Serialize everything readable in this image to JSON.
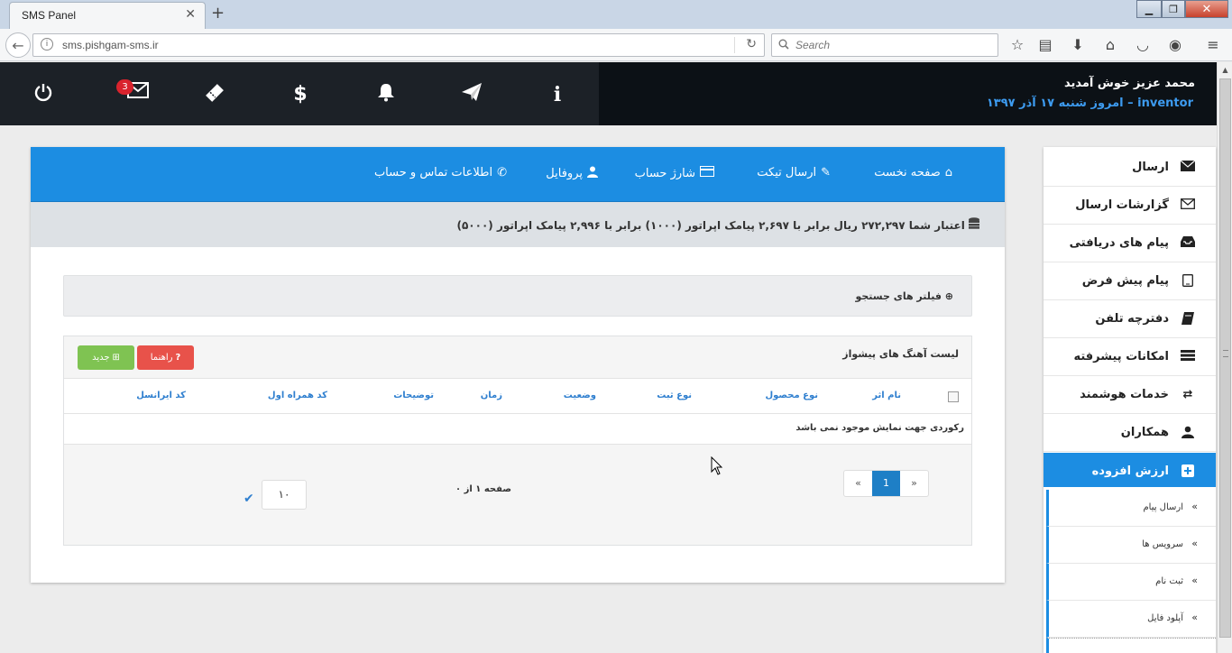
{
  "browser": {
    "tab_title": "SMS Panel",
    "url": "sms.pishgam-sms.ir",
    "search_placeholder": "Search"
  },
  "header": {
    "welcome": "محمد عزیز خوش آمدید",
    "user_line": "inventor – امروز شنبه ۱۷ آذر ۱۳۹۷",
    "mail_badge": "3",
    "icons": [
      "power-icon",
      "mail-icon",
      "ticket-icon",
      "dollar-icon",
      "bell-icon",
      "send-icon",
      "info-icon"
    ]
  },
  "panel": {
    "tabs": [
      {
        "label": "صفحه نخست",
        "icon": "home-icon"
      },
      {
        "label": "ارسال تیکت",
        "icon": "ticket-icon"
      },
      {
        "label": "شارژ حساب",
        "icon": "credit-card-icon"
      },
      {
        "label": "پروفایل",
        "icon": "user-icon"
      },
      {
        "label": "اطلاعات تماس و حساب",
        "icon": "phone-icon"
      }
    ],
    "credit": "اعتبار شما ۲۷۲,۲۹۷ ریال برابر با ۲,۶۹۷ پیامک اپراتور (۱۰۰۰) برابر با ۲,۹۹۶ پیامک اپراتور (۵۰۰۰)",
    "filter_label": "فیلتر های جستجو",
    "list_title": "لیست آهنگ های پیشواز",
    "help_button": "راهنما",
    "new_button": "جدید",
    "columns": [
      "نام اثر",
      "نوع محصول",
      "نوع ثبت",
      "وضعیت",
      "زمان",
      "توضیحات",
      "کد همراه اول",
      "کد ایرانسل"
    ],
    "empty_message": "رکوردی جهت نمایش موجود نمی باشد",
    "pager": {
      "prev": "«",
      "current": "1",
      "next": "»"
    },
    "page_info": "صفحه ۱ از ۰",
    "page_size": "۱۰"
  },
  "sidebar": {
    "items": [
      {
        "label": "ارسال",
        "icon": "envelope-icon"
      },
      {
        "label": "گزارشات ارسال",
        "icon": "envelope-outline-icon"
      },
      {
        "label": "پیام های دریافتی",
        "icon": "inbox-icon"
      },
      {
        "label": "پیام پیش فرض",
        "icon": "tablet-icon"
      },
      {
        "label": "دفترچه تلفن",
        "icon": "book-icon"
      },
      {
        "label": "امکانات پیشرفته",
        "icon": "list-icon"
      },
      {
        "label": "خدمات هوشمند",
        "icon": "retweet-icon"
      },
      {
        "label": "همکاران",
        "icon": "users-icon"
      },
      {
        "label": "ارزش افزوده",
        "icon": "plus-square-icon"
      }
    ],
    "sub_items": [
      "ارسال پیام",
      "سرویس ها",
      "ثبت نام",
      "آپلود فایل"
    ]
  },
  "colors": {
    "primary": "#1c8de2",
    "header_bg": "#1c2127",
    "danger": "#e8524a",
    "success": "#7fc352"
  }
}
